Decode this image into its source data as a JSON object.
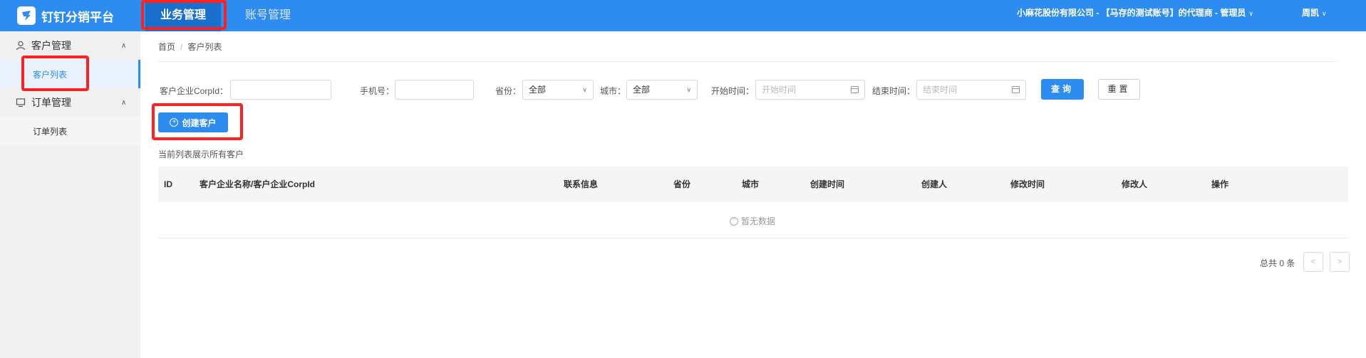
{
  "header": {
    "app_title": "钉钉分销平台",
    "nav": [
      {
        "label": "业务管理",
        "active": true
      },
      {
        "label": "账号管理",
        "active": false
      }
    ],
    "org_info": "小麻花股份有限公司 - 【马存的测试账号】的代理商 - 管理员",
    "user_name": "周凯",
    "accent_color": "#2d8cf0"
  },
  "sidebar": {
    "groups": [
      {
        "label": "客户管理",
        "icon": "user-icon",
        "expanded": true,
        "items": [
          {
            "label": "客户列表",
            "active": true
          }
        ]
      },
      {
        "label": "订单管理",
        "icon": "monitor-icon",
        "expanded": true,
        "items": [
          {
            "label": "订单列表",
            "active": false
          }
        ]
      }
    ]
  },
  "breadcrumb": [
    "首页",
    "客户列表"
  ],
  "filters": {
    "corp_id": {
      "label": "客户企业CorpId：",
      "value": "",
      "placeholder": ""
    },
    "phone": {
      "label": "手机号：",
      "value": "",
      "placeholder": ""
    },
    "province": {
      "label": "省份：",
      "value": "全部"
    },
    "city": {
      "label": "城市：",
      "value": "全部"
    },
    "start_time": {
      "label": "开始时间：",
      "placeholder": "开始时间"
    },
    "end_time": {
      "label": "结束时间：",
      "placeholder": "结束时间"
    },
    "query_label": "查询",
    "reset_label": "重置"
  },
  "create_button_label": "创建客户",
  "list_hint": "当前列表展示所有客户",
  "table": {
    "columns": [
      "ID",
      "客户企业名称/客户企业CorpId",
      "联系信息",
      "省份",
      "城市",
      "创建时间",
      "创建人",
      "修改时间",
      "修改人",
      "操作"
    ],
    "rows": [],
    "empty_text": "暂无数据"
  },
  "pagination": {
    "total_text": "总共 0 条",
    "prev": "<",
    "next": ">"
  }
}
